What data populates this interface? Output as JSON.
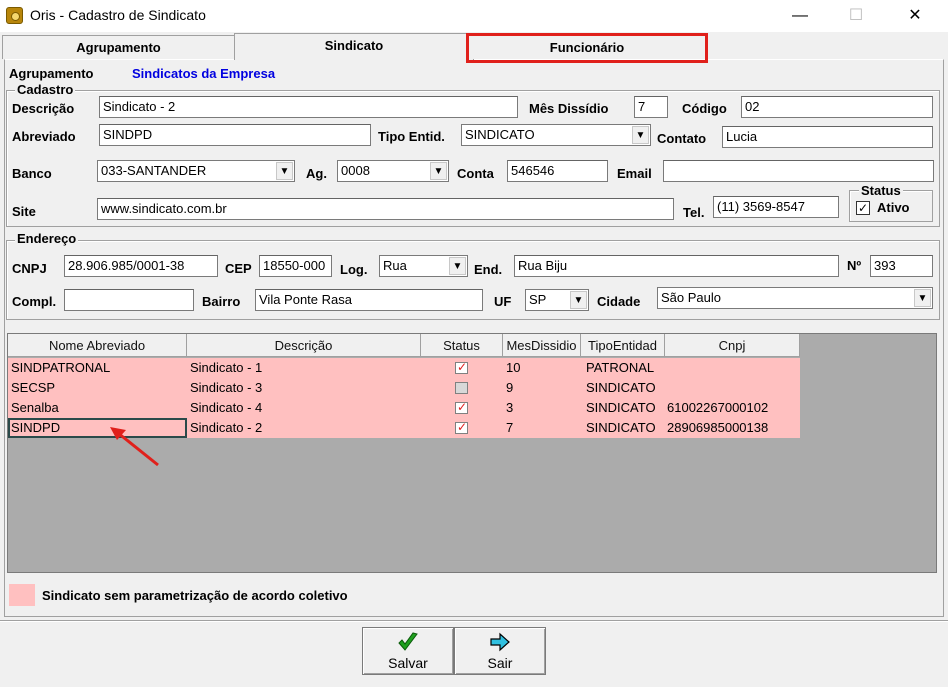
{
  "window": {
    "title": "Oris - Cadastro de Sindicato",
    "minimize": "—",
    "maximize": "☐",
    "close": "✕"
  },
  "tabs": [
    {
      "label": "Agrupamento"
    },
    {
      "label": "Sindicato"
    },
    {
      "label": "Funcionário"
    }
  ],
  "agrupamento": {
    "label": "Agrupamento",
    "value": "Sindicatos da Empresa"
  },
  "cadastro": {
    "legend": "Cadastro",
    "descricao_label": "Descrição",
    "descricao": "Sindicato - 2",
    "mes_dissidio_label": "Mês Dissídio",
    "mes_dissidio": "7",
    "codigo_label": "Código",
    "codigo": "02",
    "abreviado_label": "Abreviado",
    "abreviado": "SINDPD",
    "tipo_entid_label": "Tipo Entid.",
    "tipo_entid": "SINDICATO",
    "contato_label": "Contato",
    "contato": "Lucia",
    "banco_label": "Banco",
    "banco": "033-SANTANDER",
    "ag_label": "Ag.",
    "ag": "0008",
    "conta_label": "Conta",
    "conta": "546546",
    "email_label": "Email",
    "email": "",
    "site_label": "Site",
    "site": "www.sindicato.com.br",
    "tel_label": "Tel.",
    "tel": "(11) 3569-8547",
    "status_legend": "Status",
    "ativo_label": "Ativo",
    "ativo_check": "✓"
  },
  "endereco": {
    "legend": "Endereço",
    "cnpj_label": "CNPJ",
    "cnpj": "28.906.985/0001-38",
    "cep_label": "CEP",
    "cep": "18550-000",
    "log_label": "Log.",
    "log": "Rua",
    "end_label": "End.",
    "end": "Rua Biju",
    "numero_label": "Nº",
    "numero": "393",
    "compl_label": "Compl.",
    "compl": "",
    "bairro_label": "Bairro",
    "bairro": "Vila Ponte Rasa",
    "uf_label": "UF",
    "uf": "SP",
    "cidade_label": "Cidade",
    "cidade": "São Paulo"
  },
  "grid": {
    "columns": [
      "Nome Abreviado",
      "Descrição",
      "Status",
      "MesDissidio",
      "TipoEntidad",
      "Cnpj"
    ],
    "rows": [
      {
        "nome": "SINDPATRONAL",
        "descricao": "Sindicato - 1",
        "status": true,
        "mes": "10",
        "tipo": "PATRONAL",
        "cnpj": ""
      },
      {
        "nome": "SECSP",
        "descricao": "Sindicato - 3",
        "status": false,
        "mes": "9",
        "tipo": "SINDICATO",
        "cnpj": ""
      },
      {
        "nome": "Senalba",
        "descricao": "Sindicato - 4",
        "status": true,
        "mes": "3",
        "tipo": "SINDICATO",
        "cnpj": "61002267000102"
      },
      {
        "nome": "SINDPD",
        "descricao": "Sindicato - 2",
        "status": true,
        "mes": "7",
        "tipo": "SINDICATO",
        "cnpj": "28906985000138"
      }
    ]
  },
  "legend_note": "Sindicato sem parametrização de acordo coletivo",
  "colors": {
    "row_highlight": "#ffc0c0",
    "annotation": "#e0201b",
    "link_blue": "#0000e0"
  },
  "buttons": {
    "salvar": {
      "label": "Salvar",
      "icon": "green-check-icon"
    },
    "sair": {
      "label": "Sair",
      "icon": "exit-arrow-icon"
    }
  }
}
